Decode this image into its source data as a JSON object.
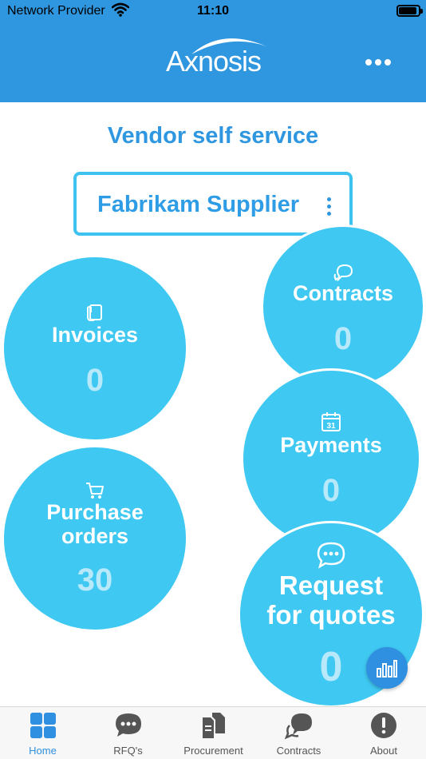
{
  "status_bar": {
    "carrier": "Network Provider",
    "time": "11:10"
  },
  "header": {
    "logo_text": "Axnosis",
    "menu_icon": "more-horizontal-icon"
  },
  "page": {
    "title": "Vendor self service"
  },
  "vendor": {
    "name": "Fabrikam Supplier",
    "menu_icon": "more-vertical-icon"
  },
  "tiles": {
    "invoices": {
      "label": "Invoices",
      "count": "0",
      "icon": "document-hand-icon"
    },
    "contracts": {
      "label": "Contracts",
      "count": "0",
      "icon": "chat-bubbles-icon"
    },
    "payments": {
      "label": "Payments",
      "count": "0",
      "icon": "calendar-icon"
    },
    "purchase_orders": {
      "label_line1": "Purchase",
      "label_line2": "orders",
      "count": "30",
      "icon": "cart-icon"
    },
    "rfq": {
      "label_line1": "Request",
      "label_line2": "for quotes",
      "count": "0",
      "icon": "chat-dots-icon"
    }
  },
  "analytics_button": {
    "icon": "bar-chart-icon"
  },
  "tab_bar": [
    {
      "label": "Home",
      "icon": "grid-icon",
      "active": true
    },
    {
      "label": "RFQ's",
      "icon": "chat-dots-icon",
      "active": false
    },
    {
      "label": "Procurement",
      "icon": "documents-icon",
      "active": false
    },
    {
      "label": "Contracts",
      "icon": "chat-bubbles-icon",
      "active": false
    },
    {
      "label": "About",
      "icon": "info-icon",
      "active": false
    }
  ],
  "colors": {
    "header": "#2f96e0",
    "tile": "#3ec8f2",
    "tile_count": "#b7e9fb",
    "accent": "#2f8fe0"
  }
}
